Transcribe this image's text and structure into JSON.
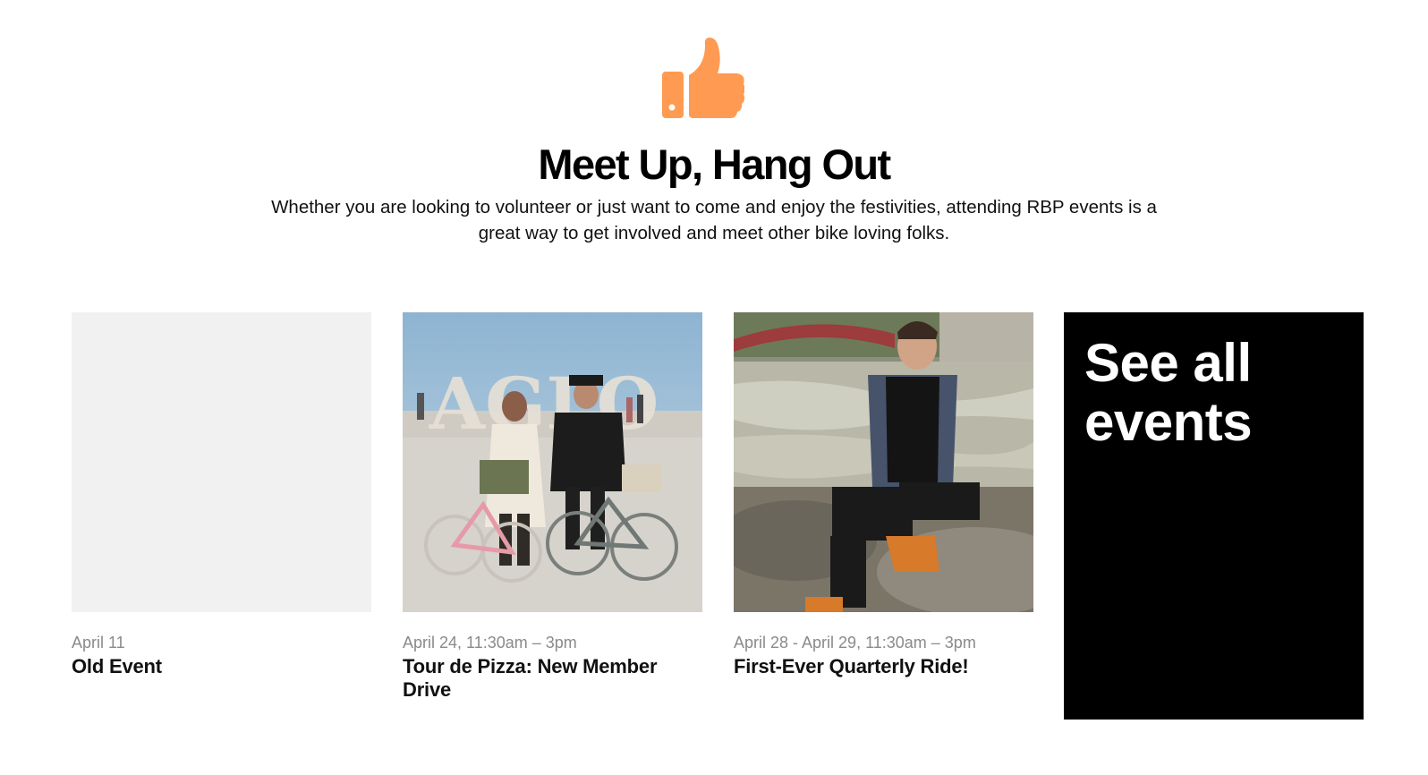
{
  "section": {
    "icon": "thumbs-up-icon",
    "accent_color": "#FF9A52",
    "title": "Meet Up, Hang Out",
    "subtitle": "Whether you are looking to volunteer or just want to come and enjoy the festivities, attending RBP events is a great way to get involved and meet other bike loving folks."
  },
  "events": [
    {
      "date": "April 11",
      "title": "Old Event",
      "image": "placeholder"
    },
    {
      "date": "April 24, 11:30am – 3pm",
      "title": "Tour de Pizza: New Member Drive",
      "image": "photo-couple-riding-bikes-desert"
    },
    {
      "date": "April 28 - April 29, 11:30am – 3pm",
      "title": "First-Ever Quarterly Ride!",
      "image": "photo-person-sitting-by-river"
    }
  ],
  "see_all": {
    "label": "See all events",
    "background": "#000000"
  }
}
